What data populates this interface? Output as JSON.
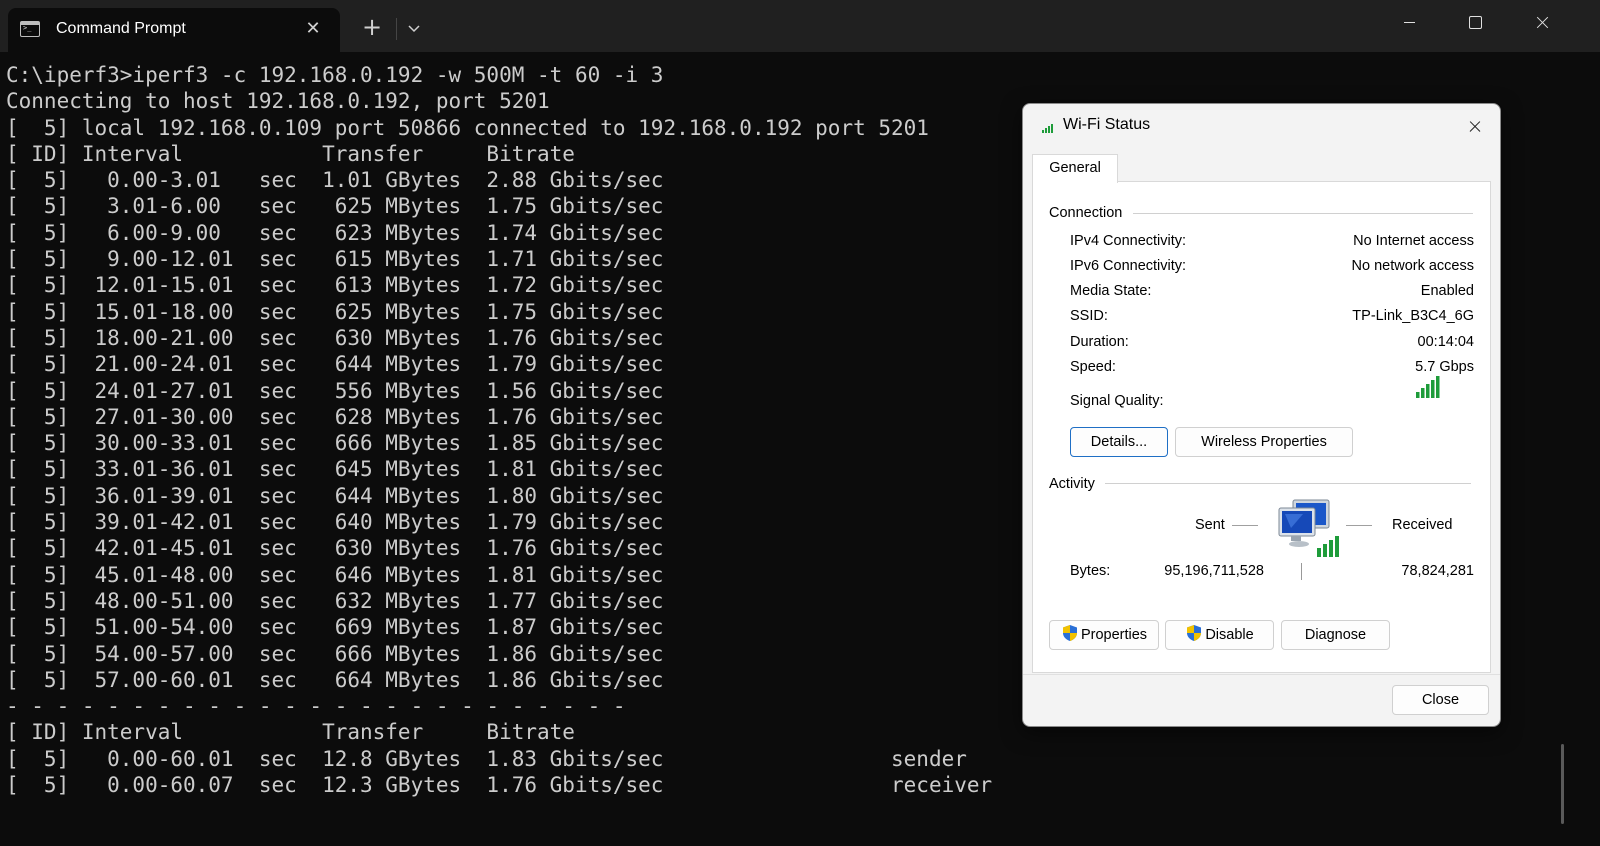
{
  "window": {
    "tab_title": "Command Prompt"
  },
  "terminal": {
    "lines": [
      "C:\\iperf3>iperf3 -c 192.168.0.192 -w 500M -t 60 -i 3",
      "Connecting to host 192.168.0.192, port 5201",
      "[  5] local 192.168.0.109 port 50866 connected to 192.168.0.192 port 5201",
      "[ ID] Interval           Transfer     Bitrate",
      "[  5]   0.00-3.01   sec  1.01 GBytes  2.88 Gbits/sec",
      "[  5]   3.01-6.00   sec   625 MBytes  1.75 Gbits/sec",
      "[  5]   6.00-9.00   sec   623 MBytes  1.74 Gbits/sec",
      "[  5]   9.00-12.01  sec   615 MBytes  1.71 Gbits/sec",
      "[  5]  12.01-15.01  sec   613 MBytes  1.72 Gbits/sec",
      "[  5]  15.01-18.00  sec   625 MBytes  1.75 Gbits/sec",
      "[  5]  18.00-21.00  sec   630 MBytes  1.76 Gbits/sec",
      "[  5]  21.00-24.01  sec   644 MBytes  1.79 Gbits/sec",
      "[  5]  24.01-27.01  sec   556 MBytes  1.56 Gbits/sec",
      "[  5]  27.01-30.00  sec   628 MBytes  1.76 Gbits/sec",
      "[  5]  30.00-33.01  sec   666 MBytes  1.85 Gbits/sec",
      "[  5]  33.01-36.01  sec   645 MBytes  1.81 Gbits/sec",
      "[  5]  36.01-39.01  sec   644 MBytes  1.80 Gbits/sec",
      "[  5]  39.01-42.01  sec   640 MBytes  1.79 Gbits/sec",
      "[  5]  42.01-45.01  sec   630 MBytes  1.76 Gbits/sec",
      "[  5]  45.01-48.00  sec   646 MBytes  1.81 Gbits/sec",
      "[  5]  48.00-51.00  sec   632 MBytes  1.77 Gbits/sec",
      "[  5]  51.00-54.00  sec   669 MBytes  1.87 Gbits/sec",
      "[  5]  54.00-57.00  sec   666 MBytes  1.86 Gbits/sec",
      "[  5]  57.00-60.01  sec   664 MBytes  1.86 Gbits/sec",
      "- - - - - - - - - - - - - - - - - - - - - - - - -",
      "[ ID] Interval           Transfer     Bitrate",
      "[  5]   0.00-60.01  sec  12.8 GBytes  1.83 Gbits/sec                  sender",
      "[  5]   0.00-60.07  sec  12.3 GBytes  1.76 Gbits/sec                  receiver"
    ]
  },
  "dialog": {
    "title": "Wi-Fi Status",
    "tab": "General",
    "connection": {
      "label": "Connection",
      "rows": [
        {
          "label": "IPv4 Connectivity:",
          "value": "No Internet access"
        },
        {
          "label": "IPv6 Connectivity:",
          "value": "No network access"
        },
        {
          "label": "Media State:",
          "value": "Enabled"
        },
        {
          "label": "SSID:",
          "value": "TP-Link_B3C4_6G"
        },
        {
          "label": "Duration:",
          "value": "00:14:04"
        },
        {
          "label": "Speed:",
          "value": "5.7 Gbps"
        }
      ],
      "signal_quality_label": "Signal Quality:",
      "signal_bars": 5
    },
    "buttons": {
      "details": "Details...",
      "wireless_properties": "Wireless Properties"
    },
    "activity": {
      "label": "Activity",
      "sent_label": "Sent",
      "received_label": "Received",
      "bytes_label": "Bytes:",
      "bytes_sent": "95,196,711,528",
      "bytes_received": "78,824,281"
    },
    "action_buttons": {
      "properties": "Properties",
      "disable": "Disable",
      "diagnose": "Diagnose"
    },
    "close_label": "Close"
  },
  "colors": {
    "terminal_bg": "#0c0c0c",
    "terminal_fg": "#cccccc",
    "signal_green": "#1e9c3a",
    "default_button_border": "#1f6fc5"
  }
}
